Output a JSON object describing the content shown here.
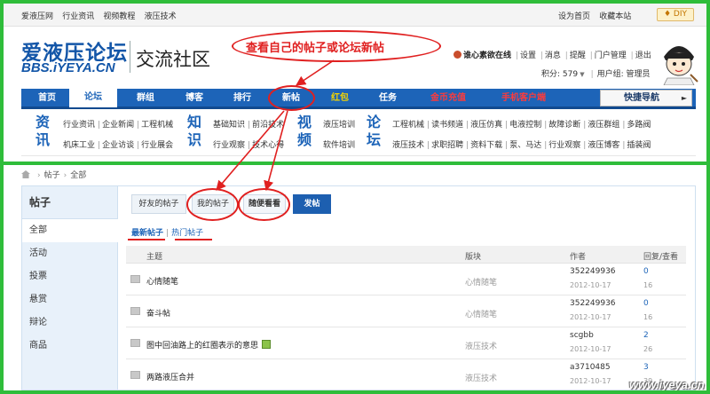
{
  "topbar": {
    "links": [
      "爱液压网",
      "行业资讯",
      "视频教程",
      "液压技术"
    ],
    "right_links": [
      "设为首页",
      "收藏本站"
    ],
    "diy_label": "♦ DIY"
  },
  "header": {
    "logo_cn": "爱液压论坛",
    "logo_en": "BBS.iYEYA.CN",
    "subtitle": "交流社区",
    "callout_text": "查看自己的帖子或论坛新帖"
  },
  "user": {
    "username": "谁心素欲在线",
    "links": [
      "设置",
      "消息",
      "提醒",
      "门户管理",
      "退出"
    ],
    "points_label": "积分: 579",
    "group_label": "用户组: 管理员"
  },
  "nav": {
    "items": [
      {
        "label": "首页",
        "style": "normal"
      },
      {
        "label": "论坛",
        "style": "active"
      },
      {
        "label": "群组",
        "style": "normal"
      },
      {
        "label": "博客",
        "style": "normal"
      },
      {
        "label": "排行",
        "style": "normal"
      },
      {
        "label": "新帖",
        "style": "normal"
      },
      {
        "label": "红包",
        "style": "yellow"
      },
      {
        "label": "任务",
        "style": "normal"
      },
      {
        "label": "金币充值",
        "style": "red"
      },
      {
        "label": "手机客户端",
        "style": "red"
      }
    ],
    "quick_nav_label": "快捷导航"
  },
  "categories": {
    "big": [
      "资讯",
      "知识",
      "视频",
      "论坛"
    ],
    "zixun_row1": [
      "行业资讯",
      "企业新闻",
      "工程机械"
    ],
    "zixun_row2": [
      "机床工业",
      "企业访谈",
      "行业展会"
    ],
    "zhishi_row1": [
      "基础知识",
      "前沿技术"
    ],
    "zhishi_row2": [
      "行业观察",
      "技术心得"
    ],
    "shipin_row1": [
      "液压培训"
    ],
    "shipin_row2": [
      "软件培训"
    ],
    "luntan_row1": [
      "工程机械",
      "读书频道",
      "液压仿真",
      "电液控制",
      "故障诊断",
      "液压群组",
      "多路阀"
    ],
    "luntan_row2": [
      "液压技术",
      "求职招聘",
      "资料下载",
      "泵、马达",
      "行业观察",
      "液压博客",
      "插装阀"
    ]
  },
  "breadcrumb": {
    "items": [
      "帖子",
      "全部"
    ]
  },
  "sidebar": {
    "title": "帖子",
    "items": [
      "全部",
      "活动",
      "投票",
      "悬赏",
      "辩论",
      "商品"
    ]
  },
  "tabs": {
    "friends": "好友的帖子",
    "mine": "我的帖子",
    "random": "随便看看",
    "post": "发帖"
  },
  "subtabs": {
    "newest": "最新帖子",
    "hot": "热门帖子"
  },
  "table": {
    "headers": {
      "subject": "主题",
      "forum": "版块",
      "author": "作者",
      "stats": "回复/查看"
    },
    "rows": [
      {
        "title": "心情随笔",
        "forum": "心情随笔",
        "author": "352249936",
        "date": "2012-10-17",
        "replies": "0",
        "views": "16",
        "has_image": false
      },
      {
        "title": "奋斗帖",
        "forum": "心情随笔",
        "author": "352249936",
        "date": "2012-10-17",
        "replies": "0",
        "views": "16",
        "has_image": false
      },
      {
        "title": "图中回油路上的红圈表示的意思",
        "forum": "液压技术",
        "author": "scgbb",
        "date": "2012-10-17",
        "replies": "2",
        "views": "26",
        "has_image": true
      },
      {
        "title": "两路液压合并",
        "forum": "液压技术",
        "author": "a3710485",
        "date": "2012-10-17",
        "replies": "3",
        "views": "39",
        "has_image": false
      }
    ]
  },
  "watermark": "www.iyeya.cn",
  "colors": {
    "frame_green": "#2fbd3a",
    "nav_blue": "#1d64b8",
    "annotation_red": "#e02020",
    "sidebar_bg": "#e8f1fa"
  }
}
